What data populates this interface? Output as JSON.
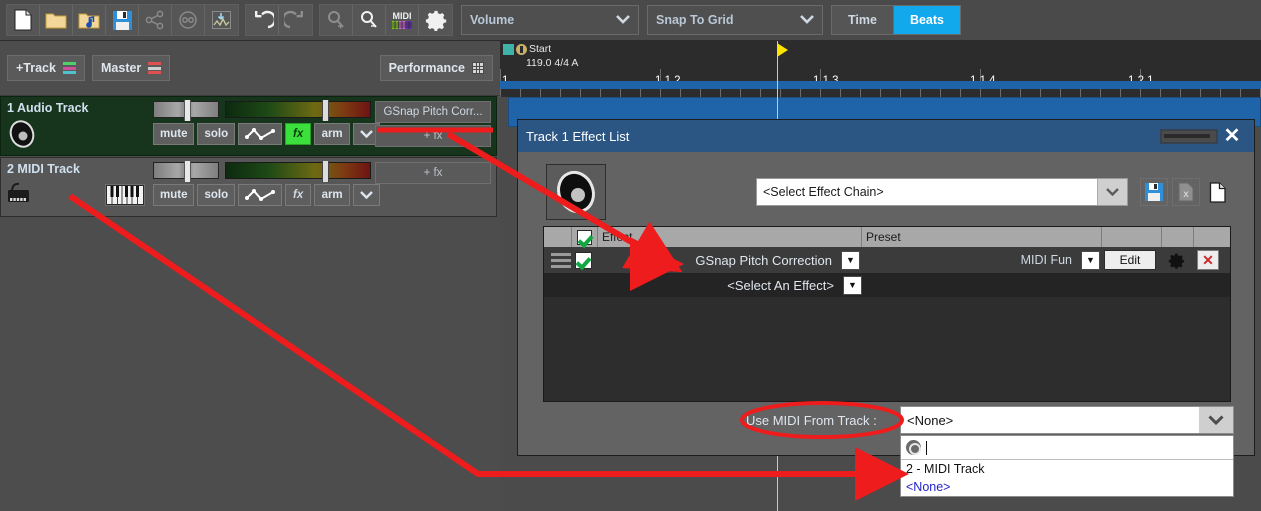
{
  "toolbar": {
    "icons": [
      {
        "name": "new-file-icon",
        "label": "New"
      },
      {
        "name": "open-folder-icon",
        "label": "Open"
      },
      {
        "name": "open-audio-folder-icon",
        "label": "Open Audio"
      },
      {
        "name": "save-icon",
        "label": "Save"
      },
      {
        "name": "share-icon",
        "label": "Share"
      },
      {
        "name": "record-disc-icon",
        "label": "Burn"
      },
      {
        "name": "export-audio-icon",
        "label": "Export"
      },
      {
        "name": "undo-icon",
        "label": "Undo"
      },
      {
        "name": "redo-icon",
        "label": "Redo"
      },
      {
        "name": "zoom-in-icon",
        "label": "Zoom In"
      },
      {
        "name": "zoom-out-icon",
        "label": "Zoom Out"
      },
      {
        "name": "midi-icon",
        "label": "MIDI"
      },
      {
        "name": "settings-gear-icon",
        "label": "Settings"
      }
    ],
    "automation_select": "Volume",
    "snap_select": "Snap To Grid",
    "time_button": "Time",
    "beats_button": "Beats"
  },
  "track_bar": {
    "add_track": "+Track",
    "master": "Master",
    "performance": "Performance"
  },
  "tracks": [
    {
      "name": "1 Audio Track",
      "type": "audio",
      "controls": [
        "mute",
        "solo",
        "arm"
      ],
      "automation_icon": "automation-curve-icon",
      "fx_label": "fx",
      "fx_enabled": true,
      "fx_slot_label": "GSnap Pitch Corr...",
      "add_fx_label": "+ fx"
    },
    {
      "name": "2 MIDI Track",
      "type": "midi",
      "controls": [
        "mute",
        "solo",
        "arm"
      ],
      "automation_icon": "automation-curve-icon",
      "fx_label": "fx",
      "fx_enabled": false,
      "fx_slot_label": "",
      "add_fx_label": "+ fx"
    }
  ],
  "timeline": {
    "start_marker": "Start",
    "tempo_info": "119.0 4/4 A",
    "ticks": [
      "1",
      "1.1.2",
      "1.1.3",
      "1.1.4",
      "1.2.1"
    ]
  },
  "dialog": {
    "title": "Track 1 Effect List",
    "restore_label": "Restore",
    "close_label": "Close",
    "chain_select_value": "<Select Effect Chain>",
    "chain_buttons": [
      {
        "name": "save-chain-icon",
        "label": "Save Chain"
      },
      {
        "name": "delete-chain-icon",
        "label": "Delete Chain"
      },
      {
        "name": "new-chain-icon",
        "label": "New Chain"
      }
    ],
    "table": {
      "columns": [
        "",
        "",
        "Effect",
        "Preset",
        "",
        "",
        ""
      ],
      "header_checkbox_checked": true,
      "rows": [
        {
          "drag_handle": "drag-handle-icon",
          "enabled": true,
          "effect": "GSnap Pitch Correction",
          "preset": "MIDI Fun",
          "edit_label": "Edit",
          "settings_icon": "gear-icon",
          "remove_icon": "close-icon"
        },
        {
          "drag_handle": "",
          "enabled": null,
          "effect": "<Select An Effect>",
          "preset": "",
          "edit_label": "",
          "settings_icon": "",
          "remove_icon": ""
        }
      ]
    },
    "midi_from_track_label": "Use MIDI From Track :",
    "midi_from_track_value": "<None>",
    "midi_search_placeholder": "",
    "midi_options": [
      "2 - MIDI Track",
      "<None>"
    ]
  },
  "colors": {
    "accent_blue": "#12a9ec",
    "title_blue": "#2b5583",
    "fx_green": "#3ce03c",
    "annotation_red": "#ee1c1c",
    "playhead_yellow": "#e8e000"
  }
}
